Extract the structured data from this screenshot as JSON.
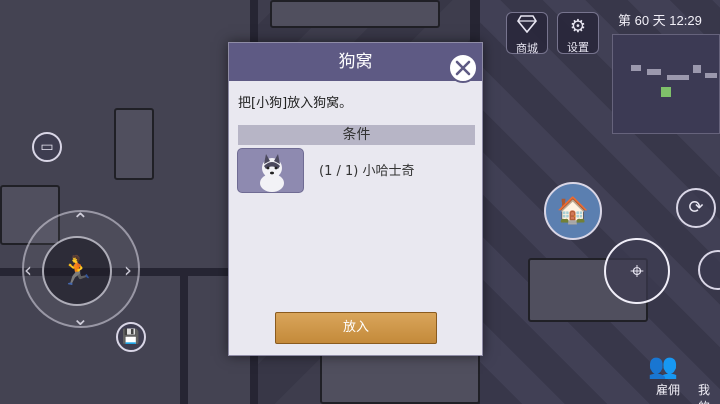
{
  "hud": {
    "shop_label": "商城",
    "settings_label": "设置",
    "day_time": "第 60 天  12:29",
    "hire_label": "雇佣",
    "mine_label": "我的"
  },
  "modal": {
    "title": "狗窝",
    "description": "把[小狗]放入狗窝。",
    "section_title": "条件",
    "requirement": {
      "count": "(1 / 1)",
      "name": "小哈士奇"
    },
    "confirm_label": "放入"
  },
  "colors": {
    "header": "#5e5a84",
    "panel": "#e9e8f0",
    "confirm": "#c48a3a"
  },
  "icons": [
    "diamond-icon",
    "gear-icon",
    "close-icon",
    "husky-icon",
    "running-man-icon",
    "save-icon",
    "dog-house-icon",
    "crosshair-icon",
    "people-icon"
  ]
}
